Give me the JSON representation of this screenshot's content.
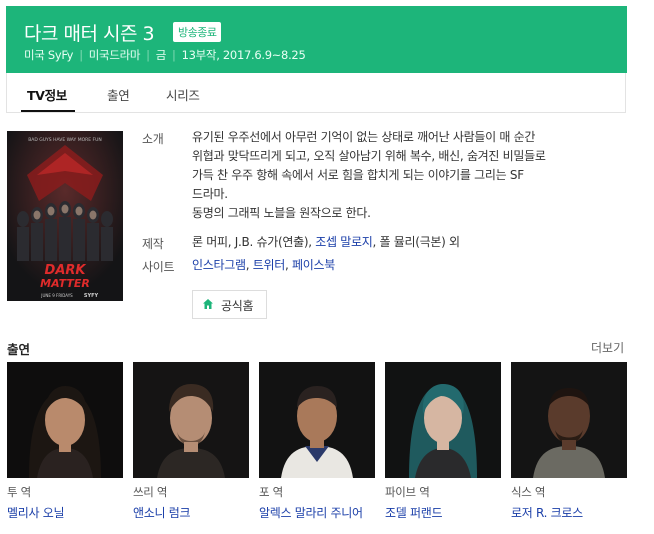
{
  "header": {
    "title": "다크 매터 시즌 3",
    "badge": "방송종료",
    "meta": [
      "미국 SyFy",
      "미국드라마",
      "금",
      "13부작, 2017.6.9~8.25"
    ]
  },
  "tabs": [
    {
      "label": "TV정보",
      "active": true
    },
    {
      "label": "출연",
      "active": false
    },
    {
      "label": "시리즈",
      "active": false
    }
  ],
  "poster": {
    "tagline": "BAD GUYS HAVE WAY MORE FUN",
    "logo_line1": "DARK",
    "logo_line2": "MATTER",
    "date": "JUNE 9 FRIDAYS",
    "network": "SYFY"
  },
  "info": {
    "synopsis_label": "소개",
    "synopsis_lines": [
      "유기된 우주선에서 아무런 기억이 없는 상태로 깨어난 사람들이 매 순간",
      "위협과 맞닥뜨리게 되고, 오직 살아남기 위해 복수, 배신, 숨겨진 비밀들로",
      "가득 찬 우주 항해 속에서 서로 힘을 합치게 되는 이야기를 그리는 SF",
      "드라마.",
      "동명의 그래픽 노블을 원작으로 한다."
    ],
    "production_label": "제작",
    "production": {
      "p1": "론 머피, J.B. 슈가(연출),",
      "p2": "조셉 말로지",
      "p3": ",",
      "p4": "조셉 말로지,",
      "p5": "폴 뮬리(극본) 외"
    },
    "site_label": "사이트",
    "sites": [
      "인스타그램",
      "트위터",
      "페이스북"
    ],
    "home_button": "공식홈"
  },
  "cast_section": {
    "title": "출연",
    "more": "더보기",
    "members": [
      {
        "role": "투 역",
        "name": "멜리사 오닐"
      },
      {
        "role": "쓰리 역",
        "name": "앤소니 럼크"
      },
      {
        "role": "포 역",
        "name": "알렉스 말라리 주니어"
      },
      {
        "role": "파이브 역",
        "name": "조델 퍼랜드"
      },
      {
        "role": "식스 역",
        "name": "로저 R. 크로스"
      }
    ]
  },
  "colors": {
    "accent": "#1db57a",
    "link": "#1a3ea8"
  }
}
